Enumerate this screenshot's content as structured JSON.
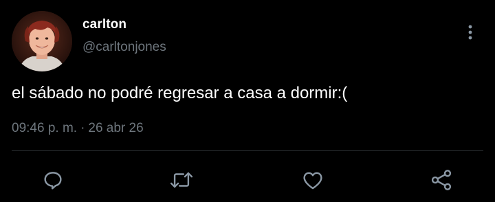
{
  "author": {
    "display_name": "carlton",
    "handle": "@carltonjones"
  },
  "tweet": {
    "text": "el sábado no podré regresar a casa a dormir:(",
    "time": "09:46 p. m.",
    "separator": "·",
    "date": "26 abr 26"
  },
  "actions": {
    "reply_icon": "comment-icon",
    "retweet_icon": "retweet-icon",
    "like_icon": "heart-icon",
    "share_icon": "share-icon",
    "more_icon": "more-vertical-icon"
  },
  "colors": {
    "background": "#000000",
    "text_primary": "#ffffff",
    "text_secondary": "#6e767d",
    "divider": "#2f3336",
    "icon": "#8b98a5"
  }
}
